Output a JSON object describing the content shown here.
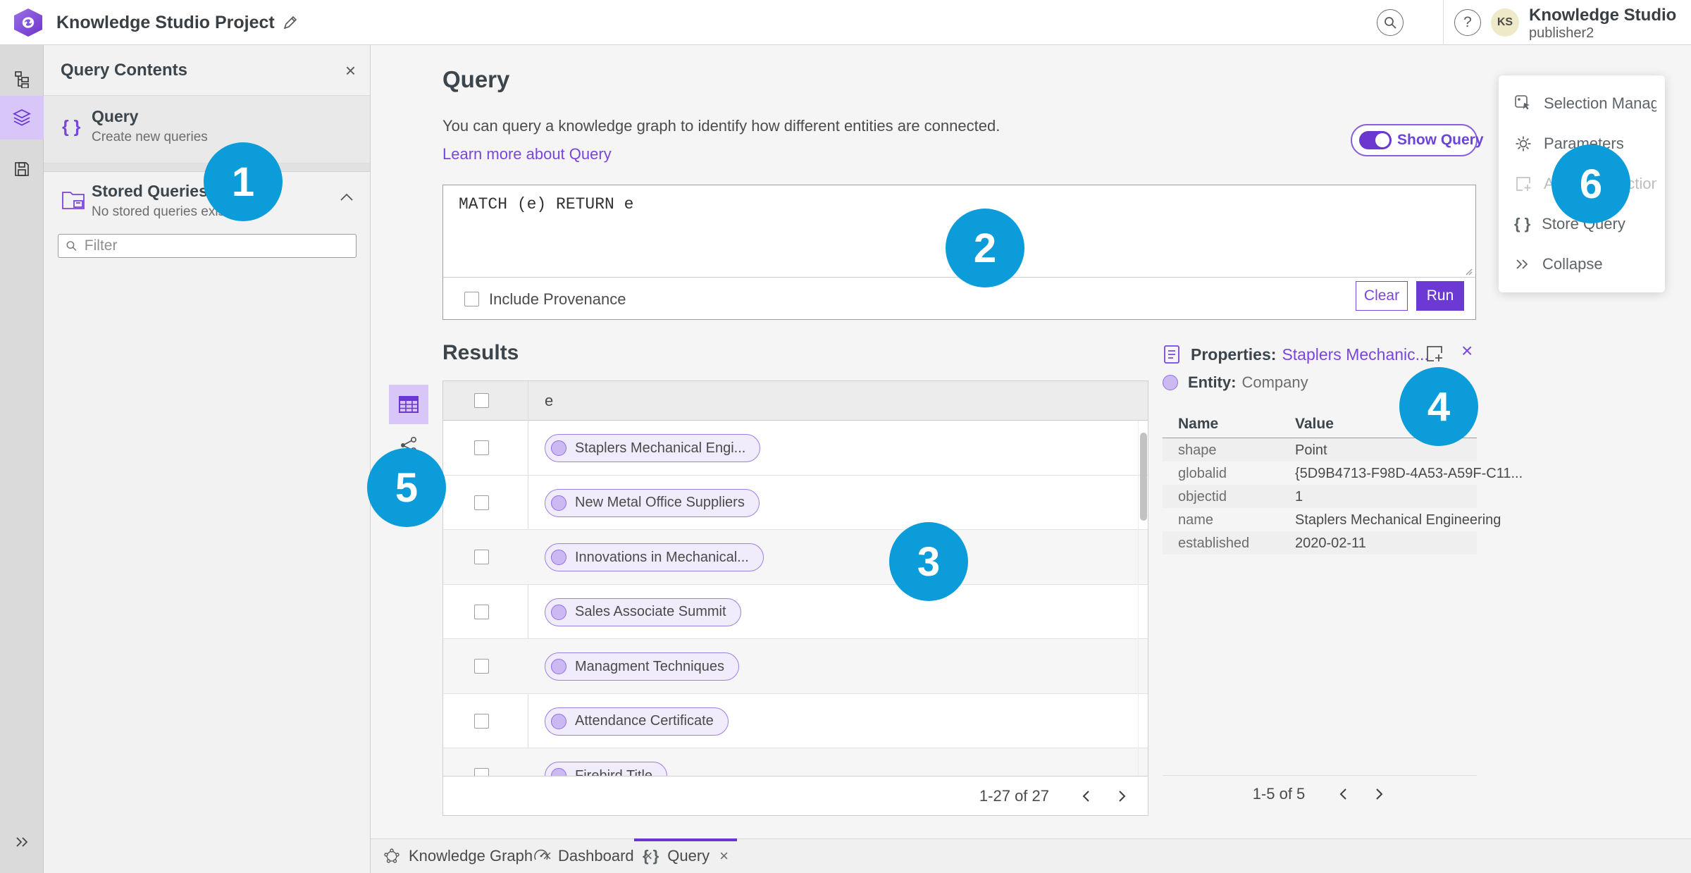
{
  "topbar": {
    "title": "Knowledge Studio Project",
    "user": {
      "initials": "KS",
      "name": "Knowledge Studio",
      "subtitle": "publisher2"
    },
    "help_glyph": "?",
    "close_glyph": "×"
  },
  "sidebar_panel": {
    "title": "Query Contents",
    "query_item": {
      "title": "Query",
      "subtitle": "Create new queries",
      "icon_glyph": "{ }"
    },
    "stored": {
      "title": "Stored Queries",
      "subtitle": "No stored queries exist"
    },
    "filter_placeholder": "Filter"
  },
  "query_section": {
    "title": "Query",
    "description": "You can query a knowledge graph to identify how different entities are connected.",
    "learn_more": "Learn more about Query",
    "show_query_label": "Show Query",
    "query_text": "MATCH (e) RETURN e",
    "include_provenance_label": "Include Provenance",
    "clear_label": "Clear",
    "run_label": "Run"
  },
  "results": {
    "title": "Results",
    "column_header": "e",
    "rows": [
      "Staplers Mechanical Engi...",
      "New Metal Office Suppliers",
      "Innovations in Mechanical...",
      "Sales Associate Summit",
      "Managment Techniques",
      "Attendance Certificate",
      "Firebird Title"
    ],
    "pagination": "1-27 of 27"
  },
  "properties": {
    "title_prefix": "Properties:",
    "title_link": "Staplers Mechanic...",
    "entity_prefix": "Entity:",
    "entity_value": "Company",
    "columns": {
      "name": "Name",
      "value": "Value"
    },
    "rows": [
      {
        "name": "shape",
        "value": "Point"
      },
      {
        "name": "globalid",
        "value": "{5D9B4713-F98D-4A53-A59F-C11..."
      },
      {
        "name": "objectid",
        "value": "1"
      },
      {
        "name": "name",
        "value": "Staplers Mechanical Engineering"
      },
      {
        "name": "established",
        "value": "2020-02-11"
      }
    ],
    "pagination": "1-5 of 5"
  },
  "actions_menu": {
    "items": [
      {
        "label": "Selection Manager"
      },
      {
        "label": "Parameters"
      },
      {
        "label": "Add To Selection"
      },
      {
        "label": "Store Query"
      },
      {
        "label": "Collapse"
      }
    ],
    "braces_glyph": "{ }"
  },
  "tabs": [
    {
      "label": "Knowledge Graph"
    },
    {
      "label": "Dashboard"
    },
    {
      "label": "Query"
    }
  ],
  "annotations": [
    "1",
    "2",
    "3",
    "4",
    "5",
    "6"
  ],
  "colors": {
    "accent_purple": "#6c39d5",
    "link_purple": "#7a45dc",
    "badge_blue": "#0c9cd9",
    "chip_bg": "#f1ecfb",
    "chip_border": "#9b7ee8",
    "rail_active_bg": "#d9c6f8",
    "avatar_bg": "#eee9c8"
  }
}
